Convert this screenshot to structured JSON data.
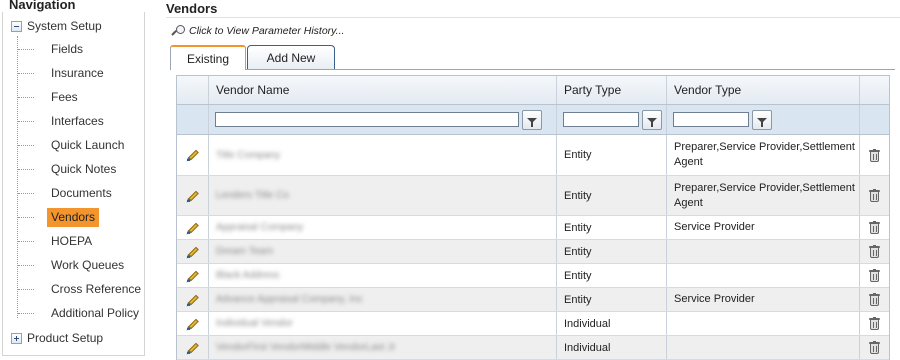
{
  "navigation": {
    "title": "Navigation",
    "system_setup": "System Setup",
    "items": [
      {
        "label": "Fields"
      },
      {
        "label": "Insurance"
      },
      {
        "label": "Fees"
      },
      {
        "label": "Interfaces"
      },
      {
        "label": "Quick Launch"
      },
      {
        "label": "Quick Notes"
      },
      {
        "label": "Documents"
      },
      {
        "label": "Vendors",
        "selected": true
      },
      {
        "label": "HOEPA"
      },
      {
        "label": "Work Queues"
      },
      {
        "label": "Cross Reference"
      },
      {
        "label": "Additional Policy"
      }
    ],
    "product_setup": "Product Setup"
  },
  "page": {
    "title": "Vendors",
    "history_link": "Click to View Parameter History...",
    "tabs": {
      "existing": "Existing",
      "add_new": "Add New"
    }
  },
  "grid": {
    "columns": {
      "vendor_name": "Vendor Name",
      "party_type": "Party Type",
      "vendor_type": "Vendor Type"
    },
    "rows": [
      {
        "vendor_name": "Title Company",
        "party_type": "Entity",
        "vendor_type": "Preparer,Service Provider,Settlement Agent"
      },
      {
        "vendor_name": "Lenders Title Co",
        "party_type": "Entity",
        "vendor_type": "Preparer,Service Provider,Settlement Agent"
      },
      {
        "vendor_name": "Appraisal Company",
        "party_type": "Entity",
        "vendor_type": "Service Provider"
      },
      {
        "vendor_name": "Dream Team",
        "party_type": "Entity",
        "vendor_type": ""
      },
      {
        "vendor_name": "Black Address",
        "party_type": "Entity",
        "vendor_type": ""
      },
      {
        "vendor_name": "Advance Appraisal Company, Inc",
        "party_type": "Entity",
        "vendor_type": "Service Provider"
      },
      {
        "vendor_name": "Individual Vendor",
        "party_type": "Individual",
        "vendor_type": ""
      },
      {
        "vendor_name": "VendorFirst VendorMiddle VendorLast Jr",
        "party_type": "Individual",
        "vendor_type": ""
      }
    ]
  },
  "colors": {
    "accent": "#f4942d",
    "header_bg": "#e3eaf2",
    "filter_bg": "#d9e5f1",
    "alt_row": "#efefef"
  }
}
